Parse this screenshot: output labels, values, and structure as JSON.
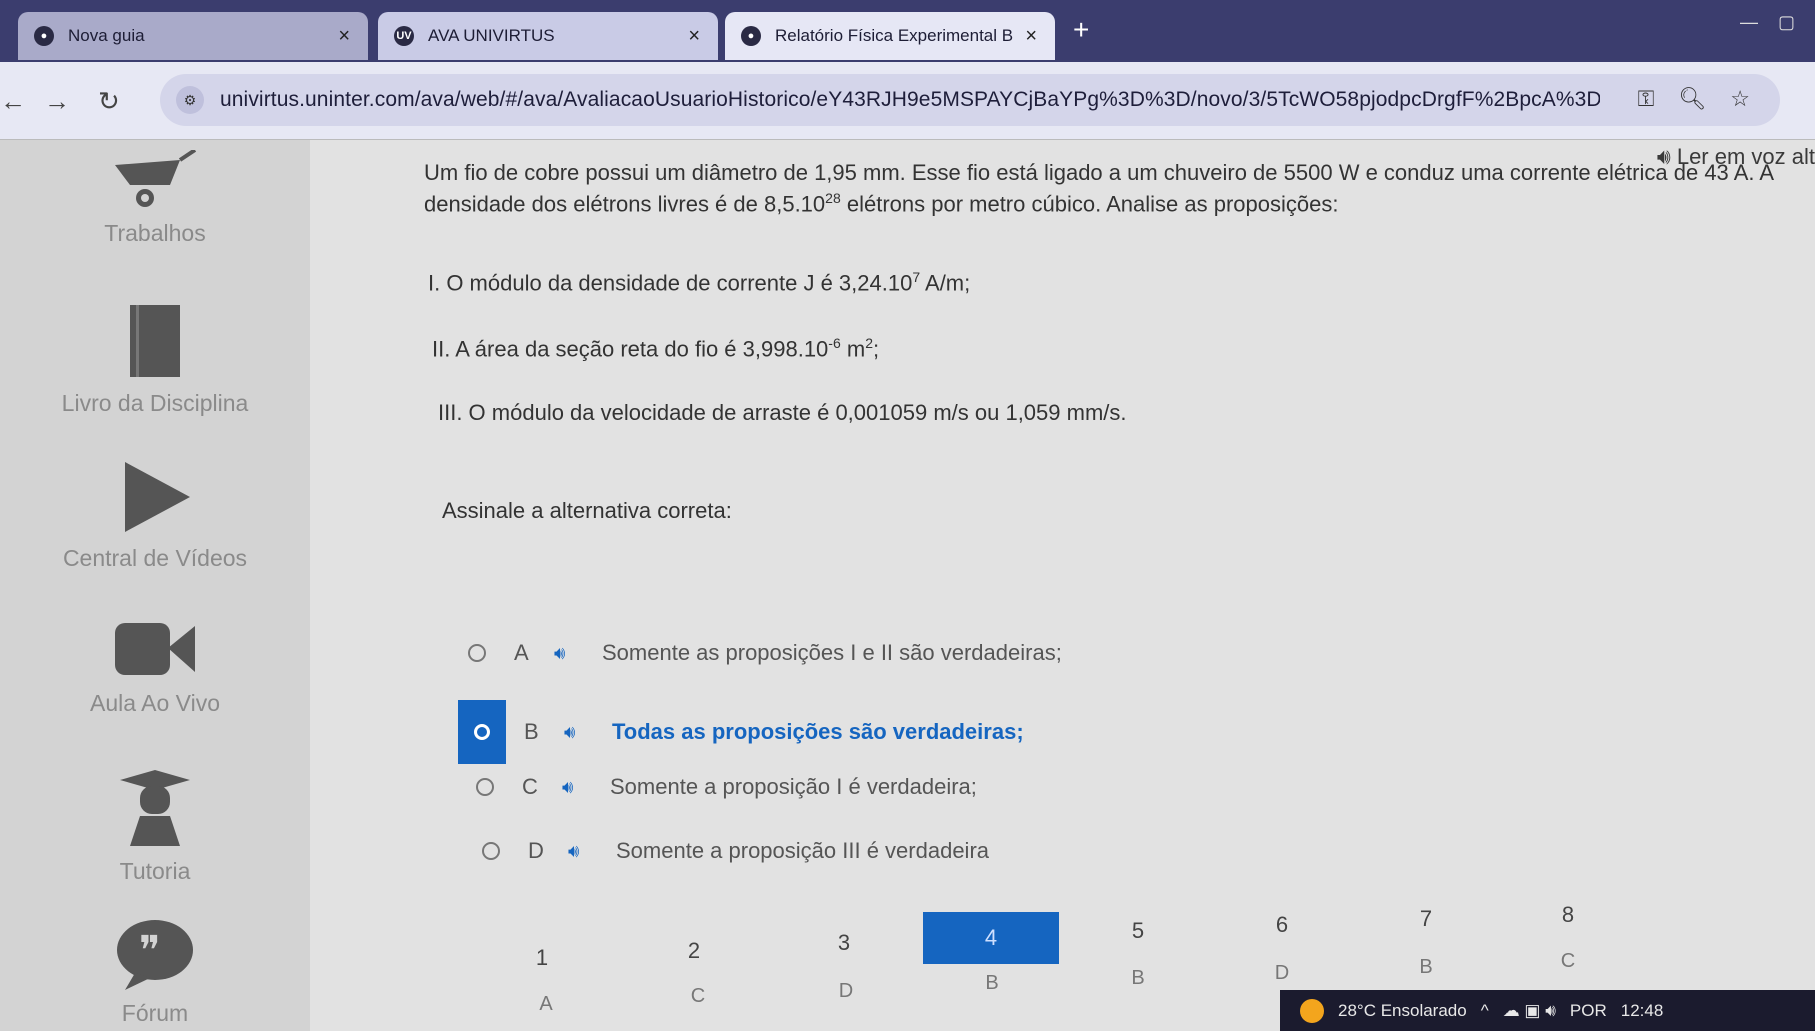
{
  "browser": {
    "tabs": [
      {
        "title": "Nova guia",
        "has_close": true
      },
      {
        "title": "AVA UNIVIRTUS",
        "has_close": true
      },
      {
        "title": "Relatório Física Experimental B",
        "has_close": true
      }
    ],
    "new_tab": "+",
    "url": "univirtus.uninter.com/ava/web/#/ava/AvaliacaoUsuarioHistorico/eY43RJH9e5MSPAYCjBaYPg%3D%3D/novo/3/5TcWO58pjodpcDrgfF%2BpcA%3D%3D"
  },
  "sidebar": {
    "items": [
      {
        "label": "Trabalhos",
        "icon": "wheelbarrow-icon"
      },
      {
        "label": "Livro da Disciplina",
        "icon": "book-icon"
      },
      {
        "label": "Central de Vídeos",
        "icon": "play-icon"
      },
      {
        "label": "Aula Ao Vivo",
        "icon": "camera-icon"
      },
      {
        "label": "Tutoria",
        "icon": "graduate-icon"
      },
      {
        "label": "Fórum",
        "icon": "quote-bubble-icon"
      }
    ]
  },
  "content": {
    "read_aloud": "Ler em voz alt",
    "question": {
      "line1": "Um fio de cobre possui um diâmetro de 1,95 mm. Esse fio está ligado a um chuveiro de 5500 W e conduz uma corrente elétrica de 43 A. A",
      "line2_pre": "densidade dos elétrons livres é de 8,5.10",
      "line2_sup": "28",
      "line2_post": " elétrons por metro cúbico. Analise as proposições:",
      "prop1_pre": "I. O módulo da densidade de corrente J é 3,24.10",
      "prop1_sup": "7",
      "prop1_post": " A/m;",
      "prop2_pre": "II. A área da seção reta do fio é 3,998.10",
      "prop2_sup": "-6",
      "prop2_mid": " m",
      "prop2_sup2": "2",
      "prop2_post": ";",
      "prop3": "III. O módulo da velocidade de arraste é 0,001059 m/s ou 1,059 mm/s.",
      "instruction": "Assinale a alternativa correta:"
    },
    "options": [
      {
        "letter": "A",
        "text": "Somente as proposições I e II são verdadeiras;",
        "selected": false
      },
      {
        "letter": "B",
        "text": "Todas as proposições são verdadeiras;",
        "selected": true
      },
      {
        "letter": "C",
        "text": "Somente a proposição I é verdadeira;",
        "selected": false
      },
      {
        "letter": "D",
        "text": "Somente a proposição III é verdadeira",
        "selected": false
      }
    ],
    "question_nav": {
      "numbers": [
        "1",
        "2",
        "3",
        "4",
        "5",
        "6",
        "7",
        "8"
      ],
      "answers": [
        "A",
        "C",
        "D",
        "B",
        "B",
        "D",
        "B",
        "C"
      ],
      "active": "4"
    }
  },
  "taskbar": {
    "weather": "28°C  Ensolarado",
    "language": "POR",
    "time": "12:48"
  },
  "colors": {
    "accent": "#1565c0",
    "tab_strip": "#3b3d6e"
  }
}
